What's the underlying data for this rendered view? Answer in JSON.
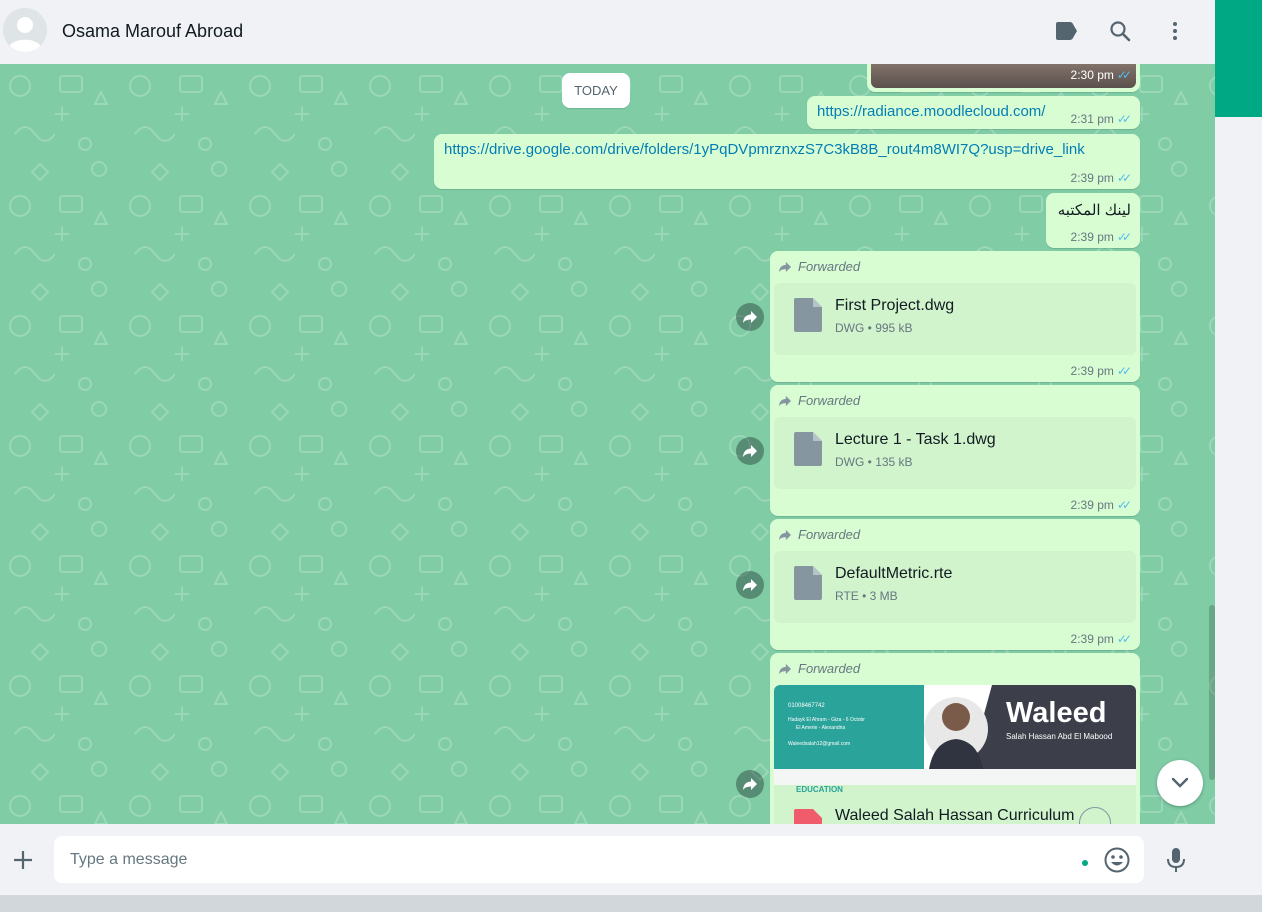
{
  "header": {
    "contact_name": "Osama Marouf Abroad",
    "icons": [
      "label-icon",
      "search-icon",
      "menu-icon"
    ]
  },
  "date_divider": "TODAY",
  "messages": [
    {
      "type": "image-tail",
      "time": "2:30 pm",
      "status": "read"
    },
    {
      "type": "link",
      "text": "https://radiance.moodlecloud.com/",
      "time": "2:31 pm",
      "status": "read"
    },
    {
      "type": "link",
      "text": "https://drive.google.com/drive/folders/1yPqDVpmrznxzS7C3kB8B_rout4m8WI7Q?usp=drive_link",
      "time": "2:39 pm",
      "status": "read"
    },
    {
      "type": "text",
      "text": "لينك المكتبه",
      "time": "2:39 pm",
      "status": "read"
    },
    {
      "type": "document",
      "forwarded_label": "Forwarded",
      "file_name": "First Project.dwg",
      "file_type": "DWG",
      "file_size": "995 kB",
      "time": "2:39 pm",
      "status": "read"
    },
    {
      "type": "document",
      "forwarded_label": "Forwarded",
      "file_name": "Lecture 1 - Task 1.dwg",
      "file_type": "DWG",
      "file_size": "135 kB",
      "time": "2:39 pm",
      "status": "read"
    },
    {
      "type": "document",
      "forwarded_label": "Forwarded",
      "file_name": "DefaultMetric.rte",
      "file_type": "RTE",
      "file_size": "3 MB",
      "time": "2:39 pm",
      "status": "read"
    },
    {
      "type": "document-preview",
      "forwarded_label": "Forwarded",
      "file_name": "Waleed Salah Hassan Curriculum",
      "preview": {
        "name": "Waleed",
        "full_name": "Salah Hassan Abd El Mabood",
        "phone": "01008467742",
        "address_line1": "Hadayk El Ahram - Giza - 6 Octobr",
        "address_line2": "El Amerie - Alexandria",
        "email": "Waleedsalah12@gmail.com",
        "section": "EDUCATION"
      }
    }
  ],
  "composer": {
    "placeholder": "Type a message",
    "value": ""
  },
  "colors": {
    "wallpaper": "#7fcca5",
    "outgoing_bubble": "#d9fdd3",
    "link": "#027eb5",
    "ticks": "#53bdeb",
    "accent": "#00a884"
  }
}
